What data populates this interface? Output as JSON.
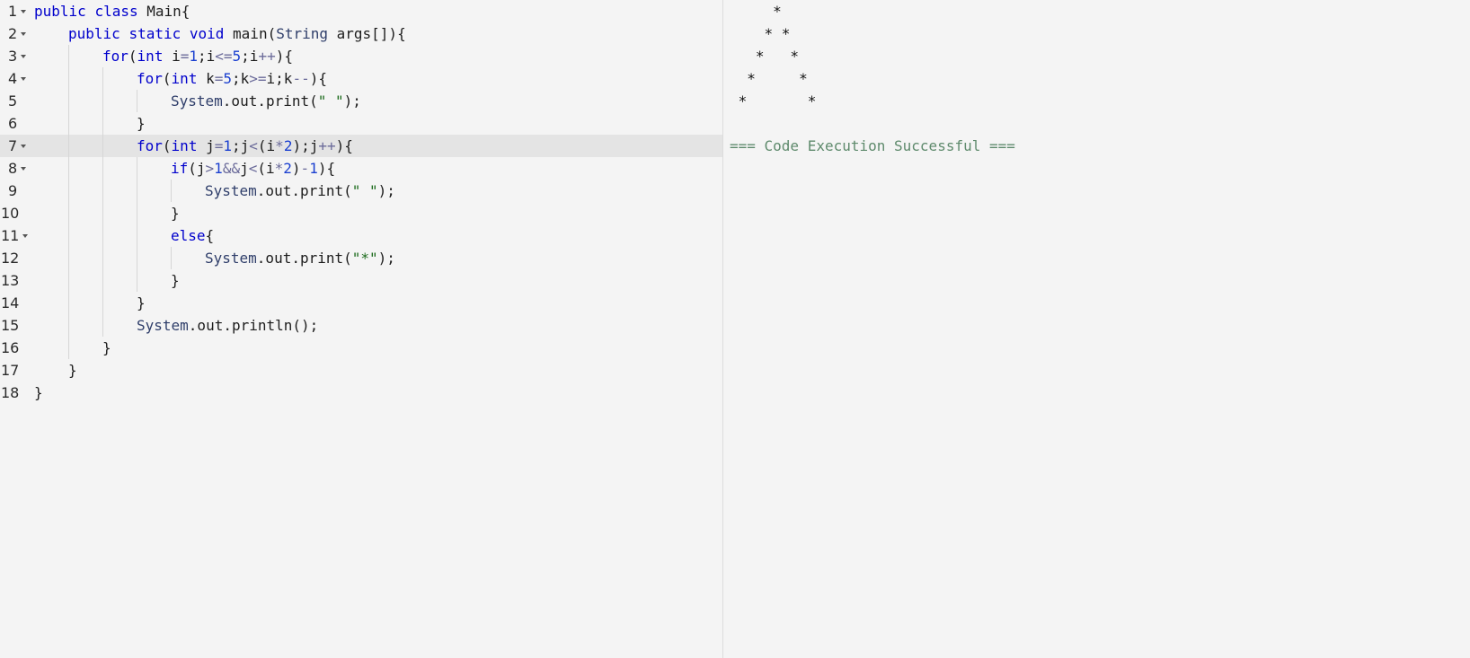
{
  "editor": {
    "active_line": 7,
    "lines": [
      {
        "no": "1",
        "fold": true,
        "indent": 0,
        "tokens": [
          [
            "kw",
            "public"
          ],
          [
            "pl",
            " "
          ],
          [
            "kw",
            "class"
          ],
          [
            "pl",
            " Main{"
          ]
        ]
      },
      {
        "no": "2",
        "fold": true,
        "indent": 1,
        "tokens": [
          [
            "kw",
            "public"
          ],
          [
            "pl",
            " "
          ],
          [
            "kw",
            "static"
          ],
          [
            "pl",
            " "
          ],
          [
            "kw",
            "void"
          ],
          [
            "pl",
            " main("
          ],
          [
            "ty",
            "String"
          ],
          [
            "pl",
            " args[]){"
          ]
        ]
      },
      {
        "no": "3",
        "fold": true,
        "indent": 2,
        "tokens": [
          [
            "kw",
            "for"
          ],
          [
            "pl",
            "("
          ],
          [
            "kw",
            "int"
          ],
          [
            "pl",
            " i"
          ],
          [
            "op",
            "="
          ],
          [
            "num",
            "1"
          ],
          [
            "pl",
            ";i"
          ],
          [
            "op",
            "<="
          ],
          [
            "num",
            "5"
          ],
          [
            "pl",
            ";i"
          ],
          [
            "op",
            "++"
          ],
          [
            "pl",
            "){"
          ]
        ]
      },
      {
        "no": "4",
        "fold": true,
        "indent": 3,
        "tokens": [
          [
            "kw",
            "for"
          ],
          [
            "pl",
            "("
          ],
          [
            "kw",
            "int"
          ],
          [
            "pl",
            " k"
          ],
          [
            "op",
            "="
          ],
          [
            "num",
            "5"
          ],
          [
            "pl",
            ";k"
          ],
          [
            "op",
            ">="
          ],
          [
            "pl",
            "i;k"
          ],
          [
            "op",
            "--"
          ],
          [
            "pl",
            "){"
          ]
        ]
      },
      {
        "no": "5",
        "fold": false,
        "indent": 4,
        "tokens": [
          [
            "cls",
            "System"
          ],
          [
            "pl",
            ".out.print("
          ],
          [
            "str",
            "\" \""
          ],
          [
            "pl",
            ");"
          ]
        ]
      },
      {
        "no": "6",
        "fold": false,
        "indent": 3,
        "tokens": [
          [
            "pl",
            "}"
          ]
        ]
      },
      {
        "no": "7",
        "fold": true,
        "indent": 3,
        "tokens": [
          [
            "kw",
            "for"
          ],
          [
            "pl",
            "("
          ],
          [
            "kw",
            "int"
          ],
          [
            "pl",
            " j"
          ],
          [
            "op",
            "="
          ],
          [
            "num",
            "1"
          ],
          [
            "pl",
            ";j"
          ],
          [
            "op",
            "<"
          ],
          [
            "pl",
            "(i"
          ],
          [
            "op",
            "*"
          ],
          [
            "num",
            "2"
          ],
          [
            "pl",
            ");j"
          ],
          [
            "op",
            "++"
          ],
          [
            "pl",
            "){"
          ]
        ]
      },
      {
        "no": "8",
        "fold": true,
        "indent": 4,
        "tokens": [
          [
            "kw",
            "if"
          ],
          [
            "pl",
            "(j"
          ],
          [
            "op",
            ">"
          ],
          [
            "num",
            "1"
          ],
          [
            "op",
            "&&"
          ],
          [
            "pl",
            "j"
          ],
          [
            "op",
            "<"
          ],
          [
            "pl",
            "(i"
          ],
          [
            "op",
            "*"
          ],
          [
            "num",
            "2"
          ],
          [
            "pl",
            ")"
          ],
          [
            "op",
            "-"
          ],
          [
            "num",
            "1"
          ],
          [
            "pl",
            "){"
          ]
        ]
      },
      {
        "no": "9",
        "fold": false,
        "indent": 5,
        "tokens": [
          [
            "cls",
            "System"
          ],
          [
            "pl",
            ".out.print("
          ],
          [
            "str",
            "\" \""
          ],
          [
            "pl",
            ");"
          ]
        ]
      },
      {
        "no": "10",
        "fold": false,
        "indent": 4,
        "tokens": [
          [
            "pl",
            "}"
          ]
        ]
      },
      {
        "no": "11",
        "fold": true,
        "indent": 4,
        "tokens": [
          [
            "kw",
            "else"
          ],
          [
            "pl",
            "{"
          ]
        ]
      },
      {
        "no": "12",
        "fold": false,
        "indent": 5,
        "tokens": [
          [
            "cls",
            "System"
          ],
          [
            "pl",
            ".out.print("
          ],
          [
            "str",
            "\"*\""
          ],
          [
            "pl",
            ");"
          ]
        ]
      },
      {
        "no": "13",
        "fold": false,
        "indent": 4,
        "tokens": [
          [
            "pl",
            "}"
          ]
        ]
      },
      {
        "no": "14",
        "fold": false,
        "indent": 3,
        "tokens": [
          [
            "pl",
            "}"
          ]
        ]
      },
      {
        "no": "15",
        "fold": false,
        "indent": 3,
        "tokens": [
          [
            "cls",
            "System"
          ],
          [
            "pl",
            ".out.println();"
          ]
        ]
      },
      {
        "no": "16",
        "fold": false,
        "indent": 2,
        "tokens": [
          [
            "pl",
            "}"
          ]
        ]
      },
      {
        "no": "17",
        "fold": false,
        "indent": 1,
        "tokens": [
          [
            "pl",
            "}"
          ]
        ]
      },
      {
        "no": "18",
        "fold": false,
        "indent": 0,
        "tokens": [
          [
            "pl",
            "}"
          ]
        ]
      }
    ]
  },
  "output": {
    "lines": [
      "     *",
      "    * *",
      "   *   *",
      "  *     *",
      " *       *",
      "",
      "=== Code Execution Successful ==="
    ],
    "status_line_index": 6
  }
}
